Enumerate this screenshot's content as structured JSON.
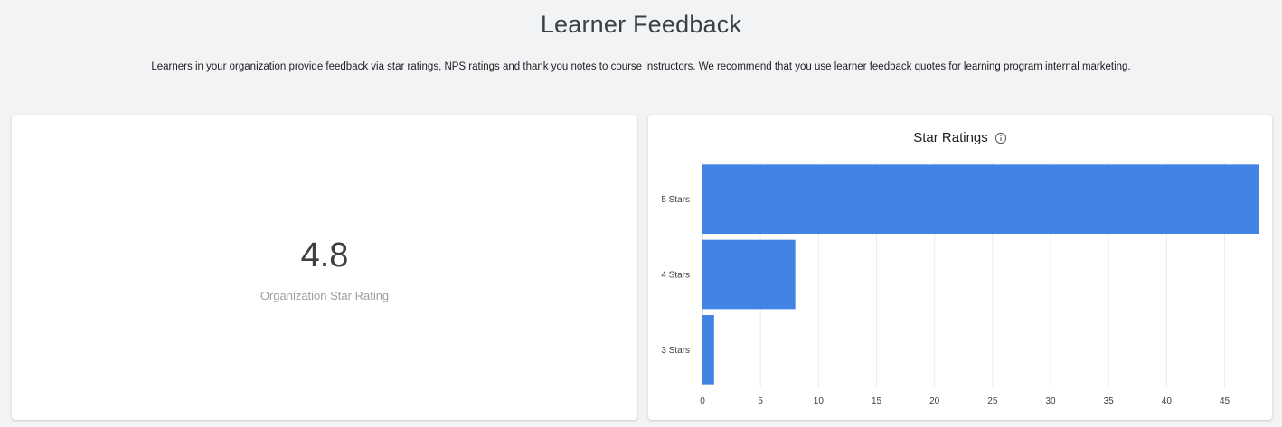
{
  "page": {
    "title": "Learner Feedback",
    "subtitle": "Learners in your organization provide feedback via star ratings, NPS ratings and thank you notes to course instructors. We recommend that you use learner feedback quotes for learning program internal marketing."
  },
  "summary_card": {
    "value": "4.8",
    "label": "Organization Star Rating"
  },
  "chart_card": {
    "title": "Star Ratings",
    "info_icon": "info-icon"
  },
  "colors": {
    "bar": "#4383e3",
    "grid": "#ececec",
    "axis": "#c8c8c8"
  },
  "chart_data": {
    "type": "bar",
    "orientation": "horizontal",
    "title": "Star Ratings",
    "categories": [
      "5 Stars",
      "4 Stars",
      "3 Stars"
    ],
    "values": [
      48,
      8,
      1
    ],
    "xlim": [
      0,
      48
    ],
    "xticks": [
      0,
      5,
      10,
      15,
      20,
      25,
      30,
      35,
      40,
      45
    ],
    "grid": true,
    "legend": "none"
  }
}
